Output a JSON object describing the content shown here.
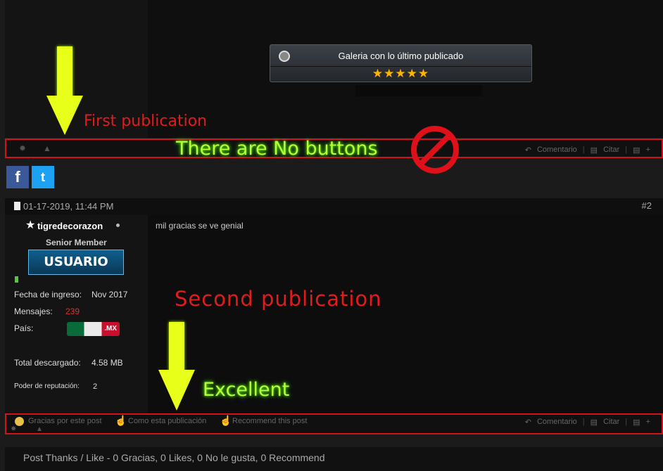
{
  "post1": {
    "gallery_title": "Galeria con lo último publicado",
    "stars": "★★★★★",
    "toolbar": {
      "reply_label": "Comentario",
      "quote_label": "Citar",
      "multiquote_label": "+"
    }
  },
  "annotations": {
    "first_publication": "First publication",
    "no_buttons": "There are No buttons",
    "second_publication": "Second publication",
    "excellent": "Excellent"
  },
  "social": {
    "facebook": "f",
    "twitter": "t"
  },
  "post2": {
    "date": "01-17-2019, 11:44 PM",
    "number": "#2",
    "username": "tigredecorazon",
    "user_title": "Senior Member",
    "badge": "USUARIO",
    "join_label": "Fecha de ingreso:",
    "join_value": "Nov 2017",
    "posts_label": "Mensajes:",
    "posts_value": "239",
    "country_label": "País:",
    "country_code": ".MX",
    "downloaded_label": "Total descargado:",
    "downloaded_value": "4.58 MB",
    "reputation_label": "Poder de reputación:",
    "reputation_value": "2",
    "message": "mil gracias se ve genial",
    "toolbar": {
      "thanks_label": "Gracias por este post",
      "like_label": "Como esta publicación",
      "recommend_label": "Recommend this post",
      "reply_label": "Comentario",
      "quote_label": "Citar",
      "multiquote_label": "+"
    }
  },
  "footer": {
    "summary": "Post Thanks / Like - 0 Gracias, 0 Likes, 0 No le gusta, 0 Recommend"
  },
  "colors": {
    "accent_red": "#d0151a",
    "annotation_green": "#b8ff3a",
    "posts_count": "#e03030"
  }
}
